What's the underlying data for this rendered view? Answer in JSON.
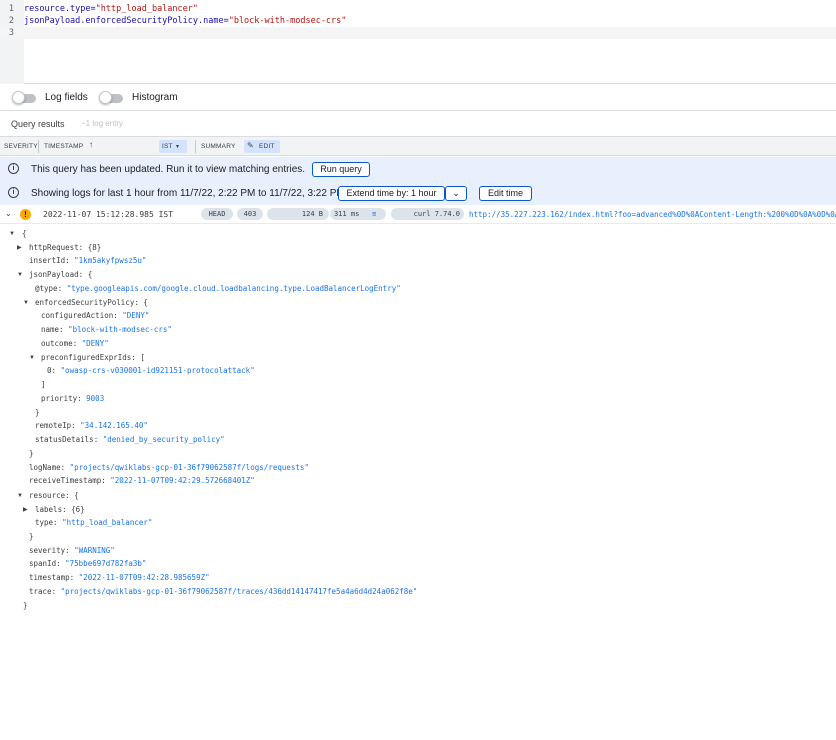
{
  "editor": {
    "lines": [
      {
        "num": "1",
        "key": "resource.type=",
        "val": "\"http_load_balancer\""
      },
      {
        "num": "2",
        "key": "jsonPayload.enforcedSecurityPolicy.name=",
        "val": "\"block-with-modsec-crs\""
      },
      {
        "num": "3",
        "key": "",
        "val": ""
      }
    ]
  },
  "toggles": {
    "log_fields": "Log fields",
    "histogram": "Histogram"
  },
  "results": {
    "title": "Query results",
    "count": "~1 log entry"
  },
  "columns": {
    "severity": "SEVERITY",
    "timestamp": "TIMESTAMP",
    "sort_icon": "arrow-up-icon",
    "tz": "IST",
    "summary": "SUMMARY",
    "edit": "EDIT"
  },
  "banner1": {
    "message": "This query has been updated. Run it to view matching entries.",
    "run_query": "Run query"
  },
  "banner2": {
    "message": "Showing logs for last 1 hour from 11/7/22, 2:22 PM to 11/7/22, 3:22 PM.",
    "extend": "Extend time by: 1 hour",
    "edit_time": "Edit time"
  },
  "entry": {
    "severity_icon": "warning-icon",
    "timestamp": "2022-11-07 15:12:28.985 IST",
    "method": "HEAD",
    "status": "403",
    "size": "124 B",
    "latency": "311 ms",
    "agent": "curl 7.74.0",
    "url": "http://35.227.223.162/index.html?foo=advanced%0D%0AContent-Length:%200%0D%0A%0D%0AHTTP/1.1%20200%20OK"
  },
  "tree": {
    "open": "{",
    "httpRequest": "httpRequest: {8}",
    "insertId_k": "insertId: ",
    "insertId_v": "\"1km5akyfpwsz5u\"",
    "jsonPayload": "jsonPayload: {",
    "type_k": "@type: ",
    "type_v": "\"type.googleapis.com/google.cloud.loadbalancing.type.LoadBalancerLogEntry\"",
    "esp": "enforcedSecurityPolicy: {",
    "ca_k": "configuredAction: ",
    "ca_v": "\"DENY\"",
    "name_k": "name: ",
    "name_v": "\"block-with-modsec-crs\"",
    "outcome_k": "outcome: ",
    "outcome_v": "\"DENY\"",
    "pre": "preconfiguredExprIds: [",
    "pre0_k": "0: ",
    "pre0_v": "\"owasp-crs-v030001-id921151-protocolattack\"",
    "close_arr": "]",
    "priority_k": "priority: ",
    "priority_v": "9003",
    "close1": "}",
    "remoteIp_k": "remoteIp: ",
    "remoteIp_v": "\"34.142.165.40\"",
    "status_k": "statusDetails: ",
    "status_v": "\"denied_by_security_policy\"",
    "close2": "}",
    "logName_k": "logName: ",
    "logName_v": "\"projects/qwiklabs-gcp-01-36f79062587f/logs/requests\"",
    "recv_k": "receiveTimestamp: ",
    "recv_v": "\"2022-11-07T09:42:29.572668401Z\"",
    "resource": "resource: {",
    "labels": "labels: {6}",
    "rtype_k": "type: ",
    "rtype_v": "\"http_load_balancer\"",
    "close3": "}",
    "severity_k": "severity: ",
    "severity_v": "\"WARNING\"",
    "span_k": "spanId: ",
    "span_v": "\"75bbe697d782fa3b\"",
    "timestamp_k": "timestamp: ",
    "timestamp_v": "\"2022-11-07T09:42:28.985659Z\"",
    "trace_k": "trace: ",
    "trace_v": "\"projects/qwiklabs-gcp-01-36f79062587f/traces/436dd14147417fe5a4a6d4d24a062f8e\"",
    "close_root": "}"
  }
}
